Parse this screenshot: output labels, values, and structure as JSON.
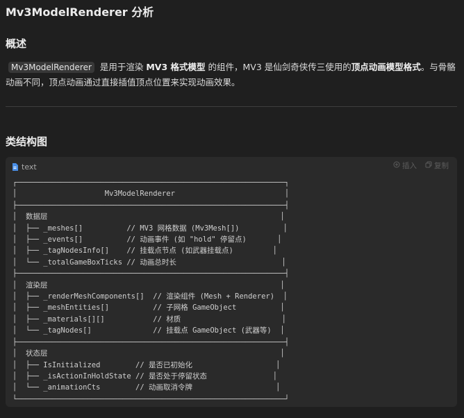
{
  "doc": {
    "title": "Mv3ModelRenderer 分析",
    "overview_heading": "概述",
    "intro": {
      "code": "Mv3ModelRenderer",
      "p1": " 是用于渲染 ",
      "b1": "MV3 格式模型",
      "p2": " 的组件，MV3 是仙剑奇侠传三使用的",
      "b2": "顶点动画模型格式",
      "p3": "。与骨骼动画不同，顶点动画通过直接插值顶点位置来实现动画效果。"
    },
    "structure_heading": "类结构图"
  },
  "codeblock": {
    "language": "text",
    "insert_label": "插入",
    "copy_label": "复制",
    "icons": {
      "lang": "file-icon",
      "insert": "insert-icon",
      "copy": "copy-icon"
    },
    "content": "┌─────────────────────────────────────────────────────────────┐\n│                    Mv3ModelRenderer                         │\n├─────────────────────────────────────────────────────────────┤\n│  数据层                                                     │\n│  ├── _meshes[]          // MV3 网格数据 (Mv3Mesh[])          │\n│  ├── _events[]          // 动画事件 (如 \"hold\" 停留点)       │\n│  ├── _tagNodesInfo[]    // 挂载点节点 (如武器挂载点)         │\n│  └── _totalGameBoxTicks // 动画总时长                        │\n├─────────────────────────────────────────────────────────────┤\n│  渲染层                                                     │\n│  ├── _renderMeshComponents[]  // 渲染组件 (Mesh + Renderer)  │\n│  ├── _meshEntities[]          // 子网格 GameObject          │\n│  ├── _materials[][]           // 材质                       │\n│  └── _tagNodes[]              // 挂载点 GameObject (武器等)  │\n├─────────────────────────────────────────────────────────────┤\n│  状态层                                                     │\n│  ├── IsInitialized        // 是否已初始化                   │\n│  ├── _isActionInHoldState // 是否处于停留状态               │\n│  └── _animationCts        // 动画取消令牌                   │\n└─────────────────────────────────────────────────────────────┘"
  }
}
